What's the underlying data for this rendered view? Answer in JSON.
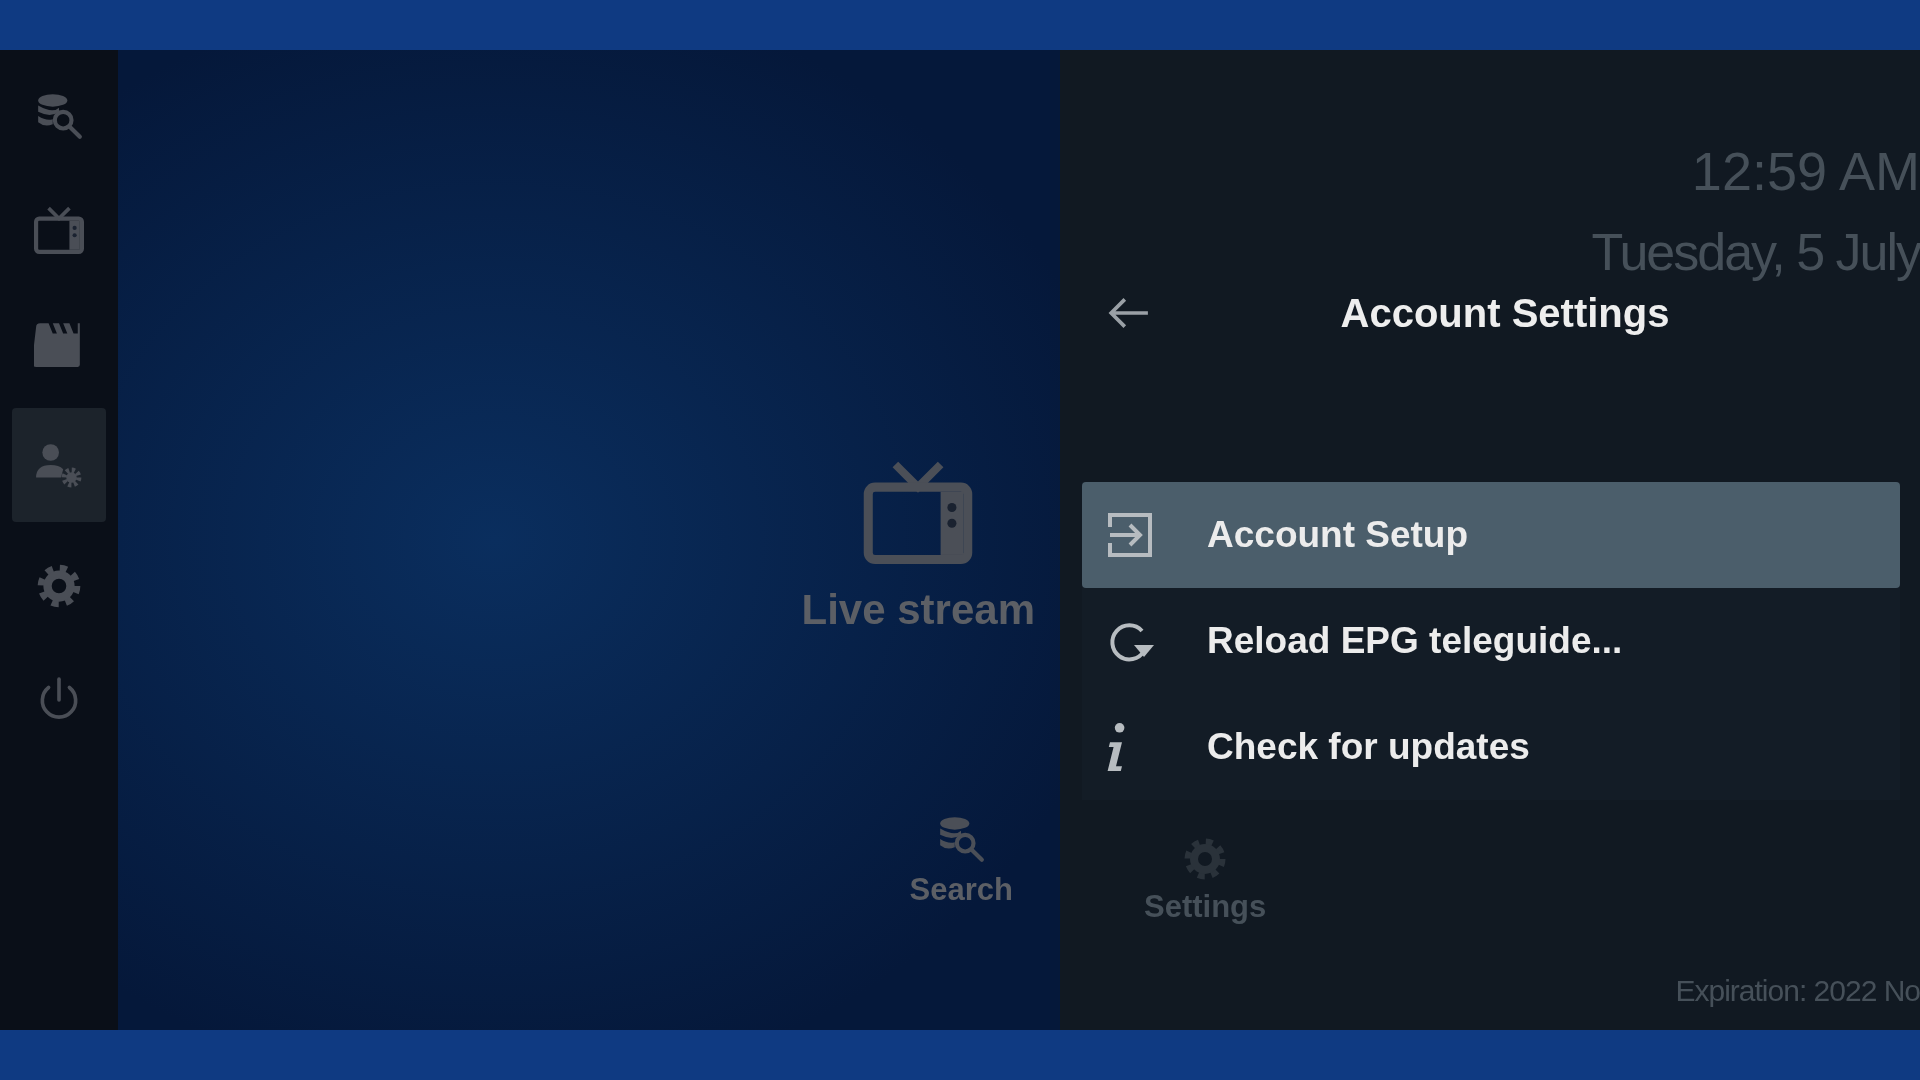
{
  "sidebar": {
    "items": [
      {
        "kind": "search",
        "selected": false
      },
      {
        "kind": "tv",
        "selected": false
      },
      {
        "kind": "clapper",
        "selected": false
      },
      {
        "kind": "user-gear",
        "selected": true
      },
      {
        "kind": "gear",
        "selected": false
      },
      {
        "kind": "power",
        "selected": false
      }
    ]
  },
  "tiles": [
    {
      "kind": "tv",
      "label": "Live stream"
    },
    {
      "kind": "search",
      "label": "Search"
    }
  ],
  "background": {
    "time": "12:59 AM",
    "date": "Tuesday, 5 July",
    "tile": {
      "kind": "gear",
      "label": "Settings"
    },
    "expiration": "Expiration: 2022 No"
  },
  "panel": {
    "title": "Account Settings",
    "items": [
      {
        "kind": "login",
        "label": "Account Setup",
        "selected": true
      },
      {
        "kind": "reload",
        "label": "Reload EPG teleguide...",
        "selected": false
      },
      {
        "kind": "info",
        "label": "Check for updates",
        "selected": false
      }
    ]
  }
}
